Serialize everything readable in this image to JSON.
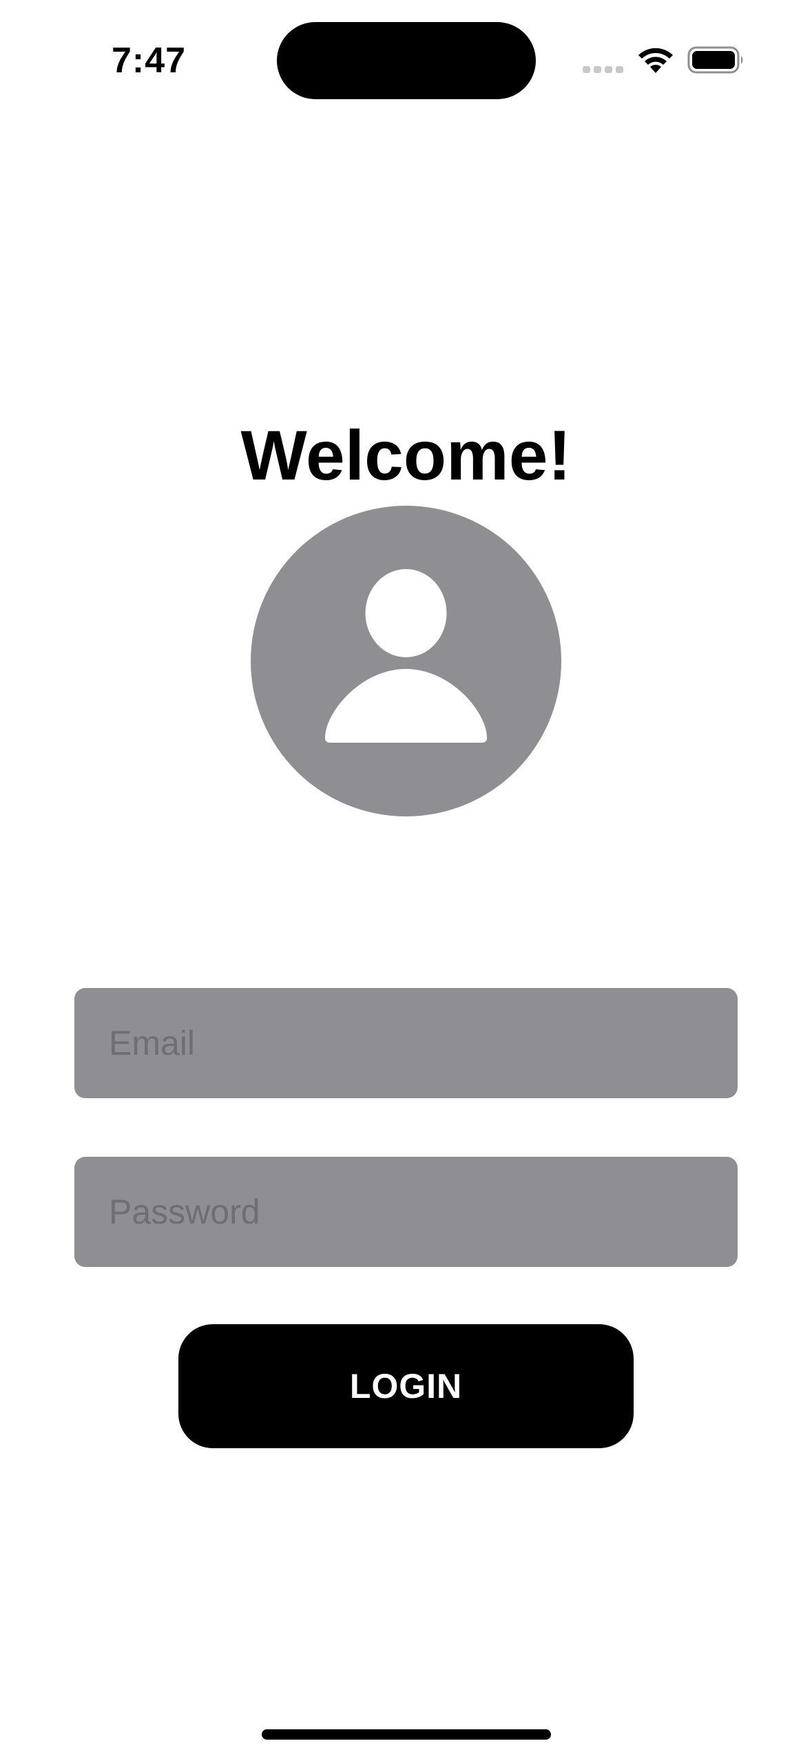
{
  "status_bar": {
    "time": "7:47",
    "icons": [
      "cellular-signal-icon",
      "wifi-icon",
      "battery-icon"
    ]
  },
  "main": {
    "title": "Welcome!",
    "avatar_icon": "person-circle-icon",
    "email_field": {
      "placeholder": "Email",
      "value": ""
    },
    "password_field": {
      "placeholder": "Password",
      "value": ""
    },
    "login_button": {
      "label": "LOGIN"
    }
  },
  "colors": {
    "background": "#ffffff",
    "field_background": "#8e8e93",
    "placeholder": "#6e6e73",
    "button_background": "#000000",
    "button_text": "#ffffff",
    "avatar": "#8e8e93"
  }
}
